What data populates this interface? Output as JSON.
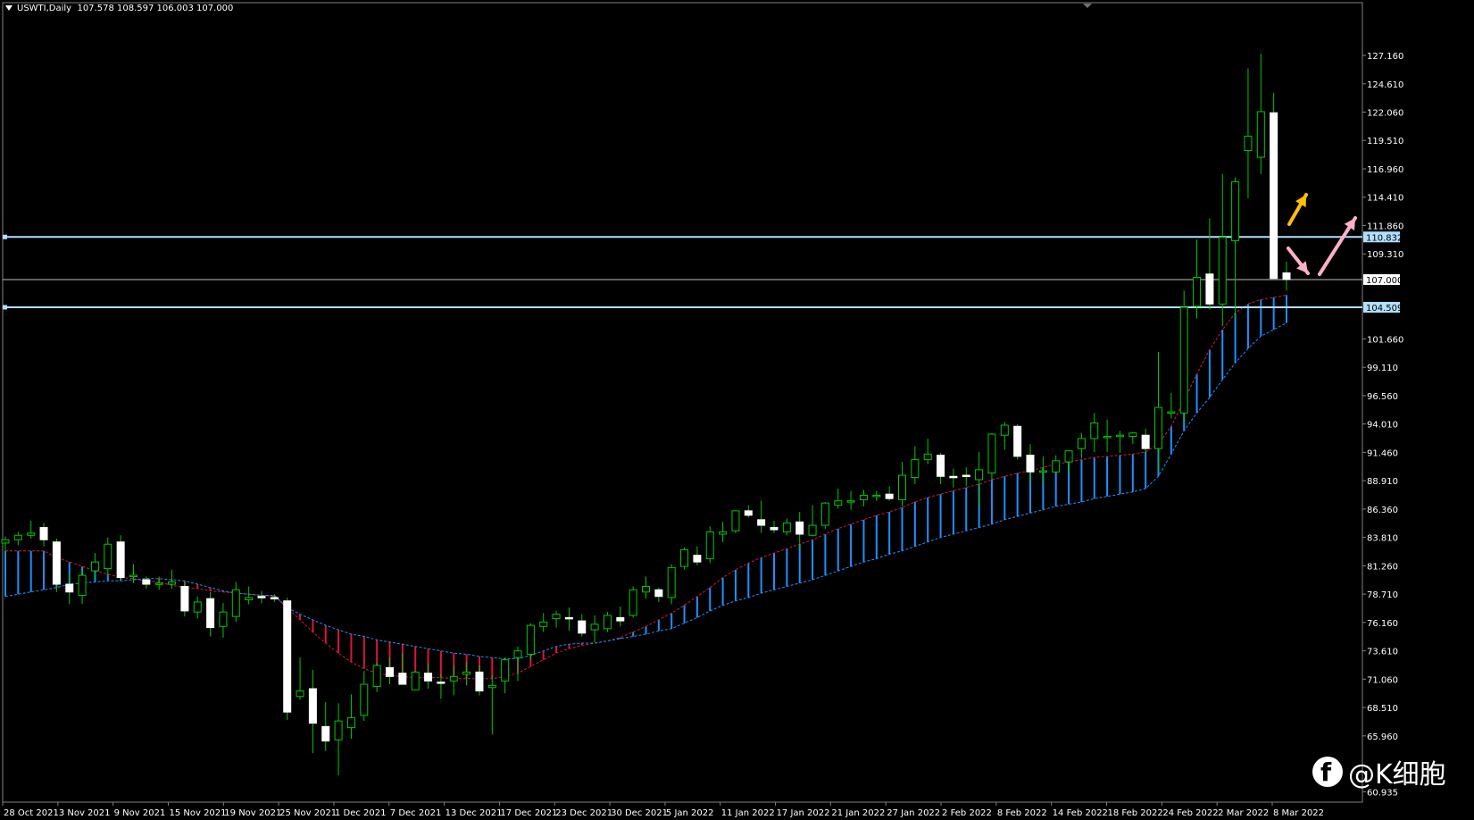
{
  "header": {
    "symbol": "USWTI,Daily",
    "ohlc": "107.578 108.597 106.003 107.000"
  },
  "watermark": {
    "text": "@K细胞",
    "icon": "facebook-icon"
  },
  "colors": {
    "background": "#000000",
    "bull": "#00c800",
    "bear_body": "#ffffff",
    "cloud_up": "#1e90ff",
    "cloud_down": "#dc143c",
    "hline": "#b0e0ff",
    "price_line": "#c0c0c0",
    "arrow_up": "#ffc000",
    "arrow_pink": "#ffb0c8"
  },
  "chart_data": {
    "type": "candlestick",
    "y_axis_ticks": [
      "127.160",
      "124.610",
      "122.060",
      "119.510",
      "116.960",
      "114.410",
      "111.860",
      "109.310",
      "107.000",
      "101.660",
      "99.110",
      "96.560",
      "94.010",
      "91.460",
      "88.910",
      "86.360",
      "83.810",
      "81.260",
      "78.710",
      "76.160",
      "73.610",
      "71.060",
      "68.510",
      "65.960",
      "60.935"
    ],
    "ylim": [
      60.935,
      128.5
    ],
    "x_axis_labels": [
      "28 Oct 2021",
      "3 Nov 2021",
      "9 Nov 2021",
      "15 Nov 2021",
      "19 Nov 2021",
      "25 Nov 2021",
      "1 Dec 2021",
      "7 Dec 2021",
      "13 Dec 2021",
      "17 Dec 2021",
      "23 Dec 2021",
      "30 Dec 2021",
      "5 Jan 2022",
      "11 Jan 2022",
      "17 Jan 2022",
      "21 Jan 2022",
      "27 Jan 2022",
      "2 Feb 2022",
      "8 Feb 2022",
      "14 Feb 2022",
      "18 Feb 2022",
      "24 Feb 2022",
      "2 Mar 2022",
      "8 Mar 2022"
    ],
    "price_tags": {
      "upper_level": "110.832",
      "current": "107.000",
      "lower_level": "104.509"
    },
    "horizontal_levels": [
      110.832,
      104.509
    ],
    "current_price": 107.0,
    "candles": [
      [
        83.3,
        83.9,
        82.6,
        83.6
      ],
      [
        83.6,
        84.3,
        83.1,
        84.0
      ],
      [
        84.0,
        85.3,
        83.7,
        84.2
      ],
      [
        84.7,
        85.1,
        83.0,
        83.6
      ],
      [
        83.4,
        83.7,
        78.9,
        79.6
      ],
      [
        79.6,
        80.6,
        77.8,
        78.9
      ],
      [
        78.6,
        81.0,
        77.8,
        80.4
      ],
      [
        80.8,
        82.4,
        80.1,
        81.6
      ],
      [
        81.0,
        83.8,
        80.3,
        83.2
      ],
      [
        83.4,
        84.0,
        79.9,
        80.2
      ],
      [
        80.3,
        81.4,
        79.7,
        80.4
      ],
      [
        80.0,
        80.3,
        79.2,
        79.6
      ],
      [
        79.7,
        80.3,
        79.1,
        79.7
      ],
      [
        79.6,
        80.9,
        79.2,
        79.8
      ],
      [
        79.4,
        79.8,
        76.7,
        77.2
      ],
      [
        77.1,
        78.5,
        76.5,
        78.0
      ],
      [
        78.3,
        78.9,
        74.9,
        75.7
      ],
      [
        75.8,
        77.9,
        74.8,
        77.1
      ],
      [
        76.7,
        79.8,
        76.2,
        79.1
      ],
      [
        78.2,
        79.4,
        77.8,
        78.4
      ],
      [
        78.5,
        79.0,
        77.9,
        78.4
      ],
      [
        78.4,
        78.7,
        78.0,
        78.3
      ],
      [
        78.1,
        78.4,
        67.4,
        68.1
      ],
      [
        69.5,
        73.0,
        69.2,
        70.0
      ],
      [
        70.2,
        71.9,
        64.4,
        67.1
      ],
      [
        66.8,
        69.0,
        64.6,
        65.5
      ],
      [
        65.6,
        68.9,
        62.4,
        67.3
      ],
      [
        66.7,
        69.7,
        65.7,
        67.6
      ],
      [
        67.8,
        71.8,
        67.3,
        70.6
      ],
      [
        70.4,
        72.5,
        69.9,
        72.3
      ],
      [
        72.1,
        73.0,
        70.6,
        71.3
      ],
      [
        71.6,
        73.4,
        70.6,
        70.6
      ],
      [
        70.1,
        71.8,
        70.1,
        71.7
      ],
      [
        71.6,
        72.5,
        70.2,
        70.9
      ],
      [
        70.8,
        71.5,
        69.3,
        70.7
      ],
      [
        70.9,
        72.3,
        69.6,
        71.3
      ],
      [
        71.5,
        72.6,
        70.5,
        71.7
      ],
      [
        71.7,
        72.3,
        69.6,
        70.0
      ],
      [
        70.3,
        71.4,
        66.1,
        70.5
      ],
      [
        70.9,
        73.0,
        69.8,
        72.8
      ],
      [
        73.0,
        74.0,
        70.9,
        73.6
      ],
      [
        73.3,
        76.1,
        72.8,
        75.9
      ],
      [
        75.8,
        77.0,
        75.3,
        76.2
      ],
      [
        76.5,
        77.2,
        75.7,
        76.9
      ],
      [
        76.6,
        77.5,
        75.4,
        76.5
      ],
      [
        76.3,
        76.9,
        74.9,
        75.2
      ],
      [
        75.5,
        76.8,
        74.4,
        76.0
      ],
      [
        75.6,
        77.1,
        75.3,
        76.8
      ],
      [
        76.6,
        77.6,
        75.8,
        76.3
      ],
      [
        76.8,
        79.4,
        76.6,
        79.1
      ],
      [
        78.9,
        80.3,
        78.3,
        79.4
      ],
      [
        79.1,
        79.3,
        78.0,
        78.5
      ],
      [
        78.4,
        81.4,
        77.8,
        81.1
      ],
      [
        81.2,
        82.9,
        80.9,
        82.7
      ],
      [
        82.2,
        83.0,
        81.3,
        81.6
      ],
      [
        81.9,
        84.8,
        81.5,
        84.3
      ],
      [
        84.1,
        85.2,
        83.4,
        84.3
      ],
      [
        84.4,
        86.2,
        84.2,
        86.2
      ],
      [
        86.2,
        86.7,
        85.6,
        85.8
      ],
      [
        85.4,
        87.1,
        84.2,
        84.9
      ],
      [
        84.7,
        85.3,
        84.2,
        84.5
      ],
      [
        84.3,
        85.5,
        84.0,
        85.1
      ],
      [
        85.2,
        86.1,
        82.8,
        84.1
      ],
      [
        84.0,
        86.7,
        83.9,
        84.9
      ],
      [
        84.9,
        87.0,
        84.6,
        86.9
      ],
      [
        86.7,
        88.2,
        86.4,
        87.1
      ],
      [
        87.0,
        88.0,
        86.3,
        87.1
      ],
      [
        87.2,
        88.1,
        86.6,
        87.6
      ],
      [
        87.5,
        88.0,
        87.1,
        87.6
      ],
      [
        87.7,
        88.4,
        87.1,
        87.3
      ],
      [
        87.2,
        90.6,
        86.6,
        89.4
      ],
      [
        89.2,
        92.0,
        88.6,
        90.8
      ],
      [
        90.8,
        92.7,
        90.4,
        91.3
      ],
      [
        91.2,
        91.4,
        88.6,
        89.3
      ],
      [
        89.3,
        90.0,
        88.3,
        89.2
      ],
      [
        89.4,
        90.1,
        88.4,
        89.3
      ],
      [
        89.0,
        91.5,
        86.6,
        89.9
      ],
      [
        89.6,
        93.2,
        89.0,
        93.1
      ],
      [
        93.0,
        94.2,
        91.7,
        93.9
      ],
      [
        93.8,
        94.0,
        90.8,
        91.1
      ],
      [
        91.2,
        92.2,
        88.8,
        89.7
      ],
      [
        89.8,
        91.1,
        88.7,
        89.8
      ],
      [
        89.7,
        91.2,
        89.6,
        90.7
      ],
      [
        90.6,
        91.5,
        89.6,
        91.6
      ],
      [
        91.8,
        93.2,
        90.9,
        92.7
      ],
      [
        92.7,
        95.0,
        91.5,
        94.1
      ],
      [
        92.9,
        94.4,
        91.5,
        92.9
      ],
      [
        92.9,
        93.4,
        91.4,
        93.0
      ],
      [
        92.9,
        93.3,
        92.2,
        93.2
      ],
      [
        93.0,
        93.6,
        91.5,
        91.8
      ],
      [
        91.8,
        100.5,
        89.8,
        95.5
      ],
      [
        95.0,
        96.8,
        94.5,
        95.1
      ],
      [
        95.0,
        106.0,
        94.2,
        104.5
      ],
      [
        104.6,
        110.6,
        103.5,
        107.2
      ],
      [
        107.5,
        112.5,
        104.3,
        104.8
      ],
      [
        104.8,
        116.5,
        102.8,
        110.8
      ],
      [
        110.5,
        116.2,
        103.5,
        115.8
      ],
      [
        118.6,
        126.0,
        114.3,
        119.9
      ],
      [
        118.0,
        127.3,
        116.5,
        122.1
      ],
      [
        122.0,
        123.8,
        107.0,
        107.1
      ],
      [
        107.6,
        108.6,
        106.0,
        107.0
      ]
    ],
    "cloud": {
      "senkou_a": [
        82.6,
        82.6,
        82.6,
        82.6,
        82.0,
        81.6,
        81.2,
        80.8,
        80.5,
        80.2,
        80.1,
        79.9,
        79.8,
        79.5,
        79.3,
        79.2,
        79.0,
        78.9,
        78.8,
        78.7,
        78.6,
        78.5,
        77.5,
        76.4,
        75.3,
        74.3,
        73.4,
        72.6,
        72.0,
        71.6,
        71.4,
        71.3,
        71.2,
        71.2,
        71.2,
        71.1,
        71.1,
        71.1,
        71.1,
        71.3,
        71.6,
        72.2,
        72.8,
        73.4,
        73.8,
        74.1,
        74.3,
        74.5,
        74.8,
        75.3,
        75.8,
        76.4,
        77.0,
        77.7,
        78.5,
        79.3,
        80.2,
        80.9,
        81.5,
        82.0,
        82.4,
        82.8,
        83.2,
        83.6,
        84.1,
        84.6,
        85.0,
        85.4,
        85.8,
        86.1,
        86.5,
        87.0,
        87.4,
        87.7,
        88.0,
        88.3,
        88.6,
        89.0,
        89.3,
        89.6,
        89.8,
        90.1,
        90.4,
        90.6,
        90.8,
        91.0,
        91.1,
        91.2,
        91.3,
        91.5,
        92.2,
        93.8,
        96.1,
        98.5,
        100.7,
        102.5,
        104.0,
        104.8,
        105.2,
        105.4,
        105.6
      ],
      "senkou_b": [
        78.5,
        78.7,
        78.9,
        79.1,
        79.3,
        79.6,
        79.7,
        79.8,
        79.9,
        79.9,
        80.0,
        80.1,
        80.1,
        80.0,
        79.9,
        79.6,
        79.3,
        79.0,
        78.8,
        78.7,
        78.6,
        78.6,
        77.5,
        76.9,
        76.4,
        75.9,
        75.5,
        75.1,
        74.9,
        74.6,
        74.4,
        74.2,
        74.0,
        73.8,
        73.6,
        73.4,
        73.3,
        73.1,
        73.0,
        72.9,
        72.9,
        73.2,
        73.6,
        74.0,
        74.2,
        74.3,
        74.3,
        74.5,
        74.7,
        74.9,
        75.1,
        75.4,
        75.6,
        76.1,
        76.6,
        77.2,
        77.7,
        78.1,
        78.4,
        78.8,
        79.1,
        79.4,
        79.7,
        80.0,
        80.4,
        80.8,
        81.2,
        81.6,
        81.9,
        82.3,
        82.6,
        83.0,
        83.4,
        83.8,
        84.1,
        84.4,
        84.7,
        85.0,
        85.4,
        85.7,
        86.0,
        86.3,
        86.6,
        86.8,
        87.0,
        87.3,
        87.5,
        87.7,
        87.9,
        88.2,
        89.3,
        91.3,
        93.4,
        95.0,
        96.4,
        98.0,
        99.5,
        100.8,
        101.9,
        102.5,
        103.1
      ],
      "offset_end": 7
    }
  }
}
